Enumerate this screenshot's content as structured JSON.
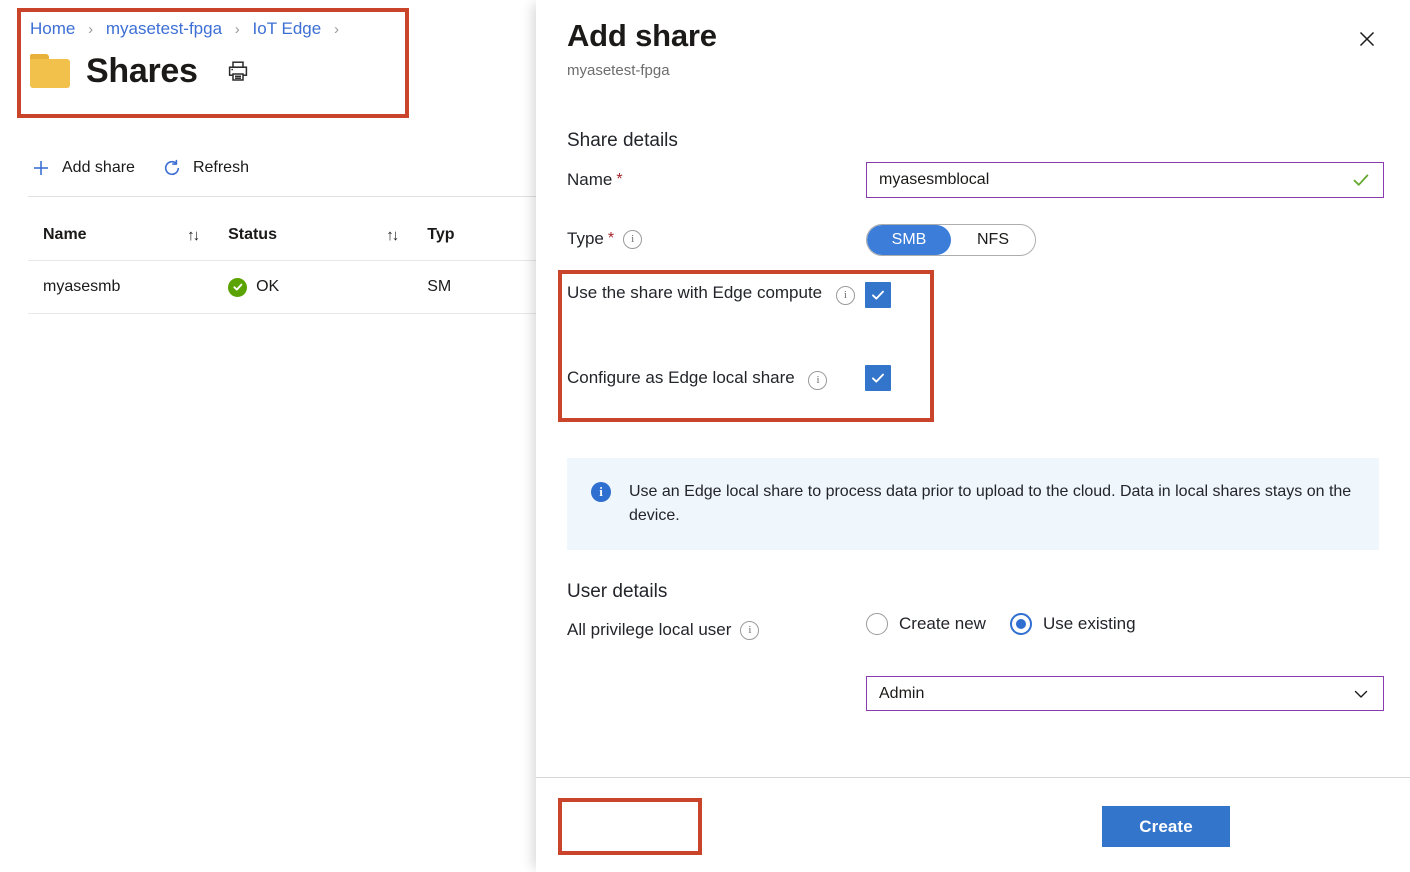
{
  "breadcrumb": {
    "items": [
      "Home",
      "myasetest-fpga",
      "IoT Edge"
    ],
    "separator": "›"
  },
  "page": {
    "title": "Shares",
    "folder_icon": "folder-icon",
    "print_icon": "printer-icon"
  },
  "toolbar": {
    "add_share": "Add share",
    "refresh": "Refresh",
    "add_icon": "plus-icon",
    "refresh_icon": "refresh-icon"
  },
  "table": {
    "columns": [
      "Name",
      "Status",
      "Typ"
    ],
    "sort_icon": "↑↓",
    "rows": [
      {
        "name": "myasesmb",
        "status": "OK",
        "status_icon": "check-circle-icon",
        "type": "SM"
      }
    ]
  },
  "panel": {
    "title": "Add share",
    "subtitle": "myasetest-fpga",
    "close_icon": "close-icon",
    "share_details_heading": "Share details",
    "name": {
      "label": "Name",
      "required": "*",
      "value": "myasesmblocal",
      "placeholder": "",
      "valid_icon": "checkmark-icon"
    },
    "type": {
      "label": "Type",
      "required": "*",
      "info_icon": "info-icon",
      "options": [
        "SMB",
        "NFS"
      ],
      "selected": "SMB"
    },
    "checkboxes": [
      {
        "label": "Use the share with Edge compute",
        "checked": true,
        "info_icon": "info-icon"
      },
      {
        "label": "Configure as Edge local share",
        "checked": true,
        "info_icon": "info-icon"
      }
    ],
    "info_banner": {
      "icon": "info-filled-icon",
      "text": "Use an Edge local share to process data prior to upload to the cloud. Data in local shares stays on the device."
    },
    "user_details_heading": "User details",
    "user": {
      "label": "All privilege local user",
      "info_icon": "info-icon",
      "options": [
        "Create new",
        "Use existing"
      ],
      "selected": "Use existing",
      "select_value": "Admin",
      "caret_icon": "chevron-down-icon"
    },
    "create_label": "Create"
  },
  "colors": {
    "annotation_red": "#c9442b",
    "accent_blue": "#3275ca",
    "toggle_blue": "#3b7dd8",
    "link_blue": "#3d6fd4",
    "status_green": "#5ba300",
    "field_focus_purple": "#8b3bb0",
    "banner_bg": "#eff6fc",
    "folder_yellow": "#f2c14b"
  }
}
